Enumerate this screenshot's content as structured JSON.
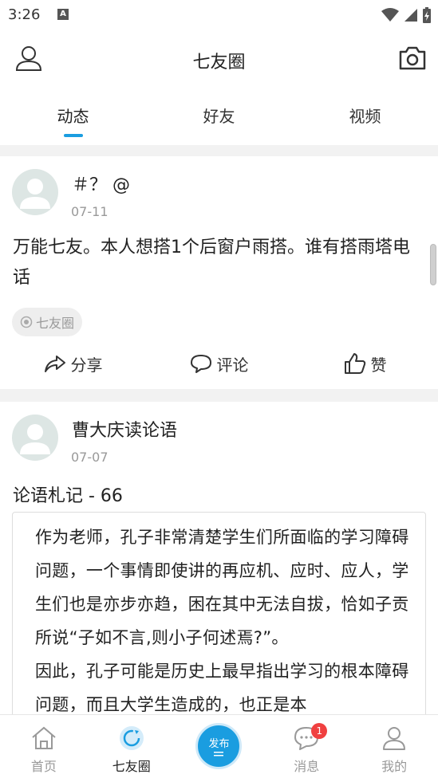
{
  "status_bar": {
    "time": "3:26",
    "notification_letter": "A"
  },
  "header": {
    "title": "七友圈"
  },
  "tabs": [
    {
      "label": "动态",
      "active": true
    },
    {
      "label": "好友",
      "active": false
    },
    {
      "label": "视频",
      "active": false
    }
  ],
  "posts": [
    {
      "author": "＃？ @",
      "date": "07-11",
      "text": "万能七友。本人想搭1个后窗户雨搭。谁有搭雨塔电话",
      "tag": "七友圈",
      "actions": {
        "share": "分享",
        "comment": "评论",
        "like": "赞"
      }
    },
    {
      "author": "曹大庆读论语",
      "date": "07-07",
      "title": "论语札记 - 66",
      "body": "作为老师，孔子非常清楚学生们所面临的学习障碍问题，一个事情即使讲的再应机、应时、应人，学生们也是亦步亦趋，困在其中无法自拔，恰如子贡所说“子如不言,则小子何述焉?”。\n因此，孔子可能是历史上最早指出学习的根本障碍问题，而且大学生造成的，也正是本"
    }
  ],
  "bottom_nav": [
    {
      "label": "首页",
      "icon": "home-icon",
      "active": false
    },
    {
      "label": "七友圈",
      "icon": "circle-refresh-icon",
      "active": true
    },
    {
      "label": "发布",
      "icon": "publish-icon",
      "active": false
    },
    {
      "label": "消息",
      "icon": "message-icon",
      "active": false,
      "badge": "1"
    },
    {
      "label": "我的",
      "icon": "profile-icon",
      "active": false
    }
  ],
  "colors": {
    "accent": "#1a9de0",
    "badge": "#f04040",
    "muted": "#999999"
  }
}
